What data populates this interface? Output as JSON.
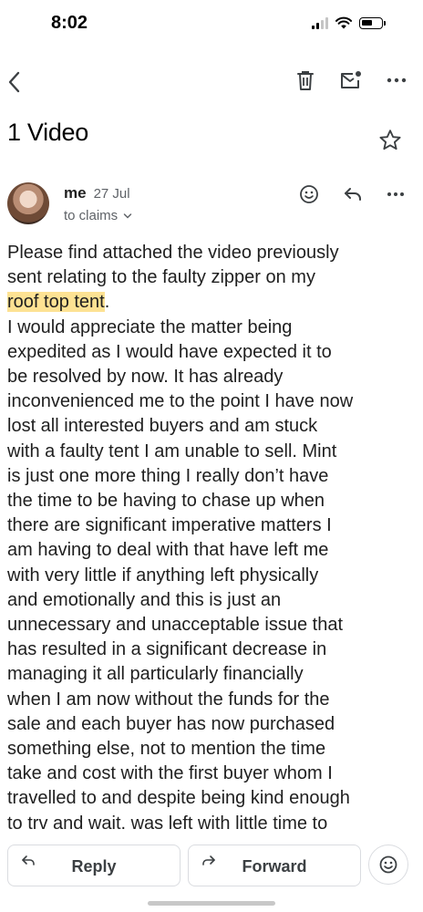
{
  "status_bar": {
    "time": "8:02"
  },
  "email": {
    "subject": "1 Video",
    "sender": "me",
    "date": "27 Jul",
    "recipient": "to claims",
    "body_lines": [
      {
        "text": "Please find attached the video previously"
      },
      {
        "text": "sent relating to the faulty zipper on my"
      },
      {
        "highlight": "roof top tent",
        "text": "."
      },
      {
        "text": "I would appreciate the matter being"
      },
      {
        "text": "expedited as I would have expected it to"
      },
      {
        "text": "be resolved by now. It has already"
      },
      {
        "text": "inconvenienced me to the point I have now"
      },
      {
        "text": "lost all interested buyers and am stuck"
      },
      {
        "text": "with a faulty tent I am unable to sell. Mint"
      },
      {
        "text": "is just one more thing I really don’t have"
      },
      {
        "text": "the time to be having to chase up when"
      },
      {
        "text": "there are significant imperative matters I"
      },
      {
        "text": "am having to deal with that have left me"
      },
      {
        "text": "with very little if anything left physically"
      },
      {
        "text": "and emotionally and this is just an"
      },
      {
        "text": "unnecessary and unacceptable issue that"
      },
      {
        "text": "has resulted in a significant decrease in"
      },
      {
        "text": "managing it all particularly financially"
      },
      {
        "text": "when I am now without the funds for the"
      },
      {
        "text": "sale and each buyer has now purchased"
      },
      {
        "text": "something else, not to mention the time"
      },
      {
        "text": "take and cost with the first buyer whom I"
      },
      {
        "text": "travelled to and despite being kind enough"
      },
      {
        "text": "to trv and wait. was left with little time to"
      }
    ]
  },
  "actions": {
    "reply_label": "Reply",
    "forward_label": "Forward"
  },
  "icons": {
    "back": "chevron-left-icon",
    "delete": "trash-icon",
    "mark_unread": "mail-unread-icon",
    "more": "more-horizontal-icon",
    "star": "star-outline-icon",
    "emoji": "emoji-icon",
    "reply": "reply-icon",
    "forward": "forward-icon"
  },
  "colors": {
    "highlight": "#fde293",
    "secondary_text": "#5f6368"
  }
}
